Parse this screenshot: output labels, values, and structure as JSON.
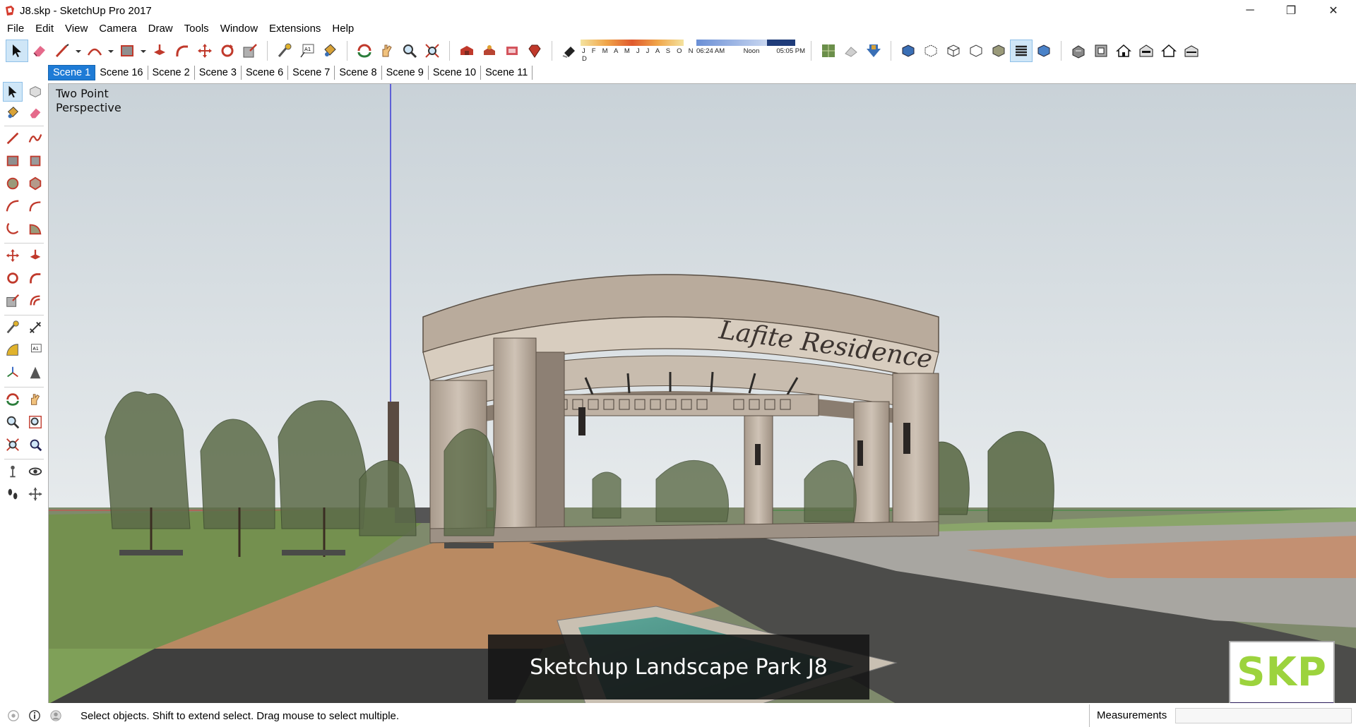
{
  "window": {
    "title": "J8.skp - SketchUp Pro 2017",
    "controls": {
      "minimize": "─",
      "restore": "❐",
      "close": "✕"
    }
  },
  "menu": [
    "File",
    "Edit",
    "View",
    "Camera",
    "Draw",
    "Tools",
    "Window",
    "Extensions",
    "Help"
  ],
  "shadow_settings": {
    "months": "J F M A M J J A S O N D",
    "time_start": "06:24 AM",
    "time_mid": "Noon",
    "time_end": "05:05 PM"
  },
  "scenes": {
    "active": "Scene 1",
    "tabs": [
      "Scene 1",
      "Scene 16",
      "Scene 2",
      "Scene 3",
      "Scene 6",
      "Scene 7",
      "Scene 8",
      "Scene 9",
      "Scene 10",
      "Scene 11"
    ]
  },
  "viewport": {
    "camera_mode_line1": "Two Point",
    "camera_mode_line2": "Perspective",
    "pavilion_signage": "Lafite Residence",
    "caption": "Sketchup Landscape Park J8",
    "badge": "SKP"
  },
  "status": {
    "message": "Select objects. Shift to extend select. Drag mouse to select multiple.",
    "measurements_label": "Measurements",
    "measurements_value": ""
  },
  "colors": {
    "active_tab": "#1e7bd6",
    "sky": "#d6dde2",
    "grass": "#6f8f4e",
    "paving": "#b98a62",
    "badge_text": "#9cd33d"
  }
}
